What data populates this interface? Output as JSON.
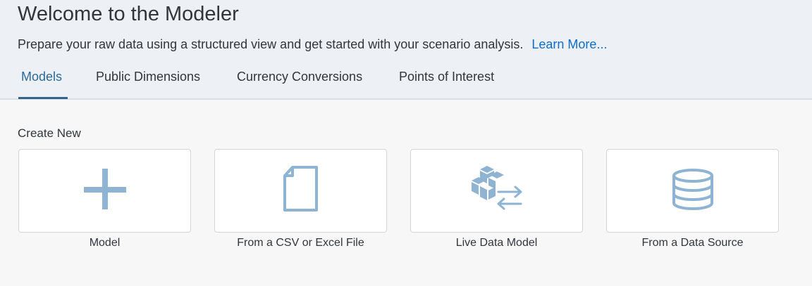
{
  "header": {
    "title": "Welcome to the Modeler",
    "subtitle": "Prepare your raw data using a structured view and get started with your scenario analysis.",
    "learn_more": "Learn More..."
  },
  "tabs": [
    {
      "label": "Models",
      "active": true
    },
    {
      "label": "Public Dimensions",
      "active": false
    },
    {
      "label": "Currency Conversions",
      "active": false
    },
    {
      "label": "Points of Interest",
      "active": false
    }
  ],
  "create_new": {
    "label": "Create New",
    "tiles": [
      {
        "label": "Model",
        "icon": "plus-icon"
      },
      {
        "label": "From a CSV or Excel File",
        "icon": "document-icon"
      },
      {
        "label": "Live Data Model",
        "icon": "live-data-icon"
      },
      {
        "label": "From a Data Source",
        "icon": "database-icon"
      }
    ]
  },
  "colors": {
    "accent": "#346187",
    "link": "#0a6ed1",
    "icon": "#8fb4d3",
    "header_bg": "#edf0f4"
  }
}
